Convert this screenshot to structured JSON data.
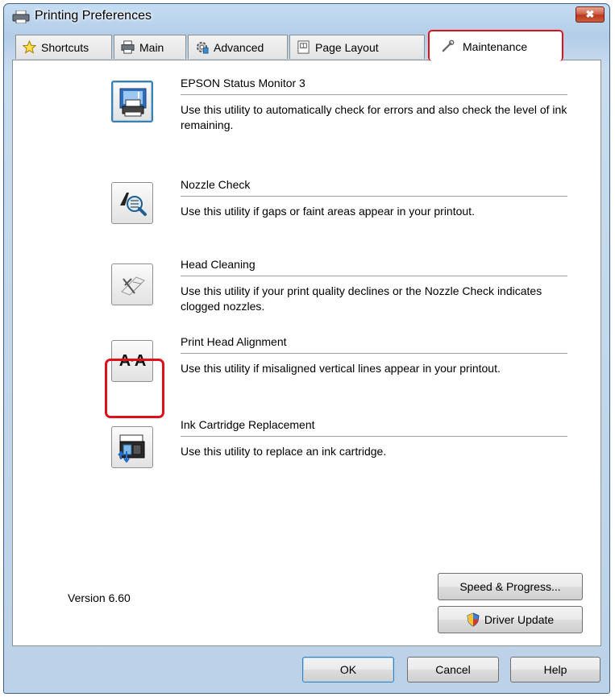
{
  "window": {
    "title": "Printing Preferences",
    "close_label": "✖"
  },
  "tabs": [
    {
      "label": "Shortcuts",
      "icon": "star-icon"
    },
    {
      "label": "Main",
      "icon": "printer-icon"
    },
    {
      "label": "Advanced",
      "icon": "gear-icon"
    },
    {
      "label": "Page Layout",
      "icon": "page-layout-icon"
    },
    {
      "label": "Maintenance",
      "icon": "wrench-icon",
      "active": true
    }
  ],
  "utilities": [
    {
      "title": "EPSON Status Monitor 3",
      "description": "Use this utility to automatically check for errors and also check the level of ink remaining.",
      "icon": "status-monitor-icon"
    },
    {
      "title": "Nozzle Check",
      "description": "Use this utility if gaps or faint areas appear in your printout.",
      "icon": "nozzle-check-icon"
    },
    {
      "title": "Head Cleaning",
      "description": "Use this utility if your print quality declines or the Nozzle Check indicates clogged nozzles.",
      "icon": "head-cleaning-icon"
    },
    {
      "title": "Print Head Alignment",
      "description": "Use this utility if misaligned vertical lines appear in your printout.",
      "icon": "print-head-alignment-icon",
      "glyph": "A·A"
    },
    {
      "title": "Ink Cartridge Replacement",
      "description": "Use this utility to replace an ink cartridge.",
      "icon": "ink-cartridge-icon"
    }
  ],
  "side_buttons": {
    "speed_progress": "Speed & Progress...",
    "driver_update": "Driver Update"
  },
  "version": "Version 6.60",
  "footer": {
    "ok": "OK",
    "cancel": "Cancel",
    "help": "Help"
  },
  "colors": {
    "highlight": "#e0101a",
    "title_bar": "#b9d1ea",
    "close_button": "#c8442a"
  }
}
